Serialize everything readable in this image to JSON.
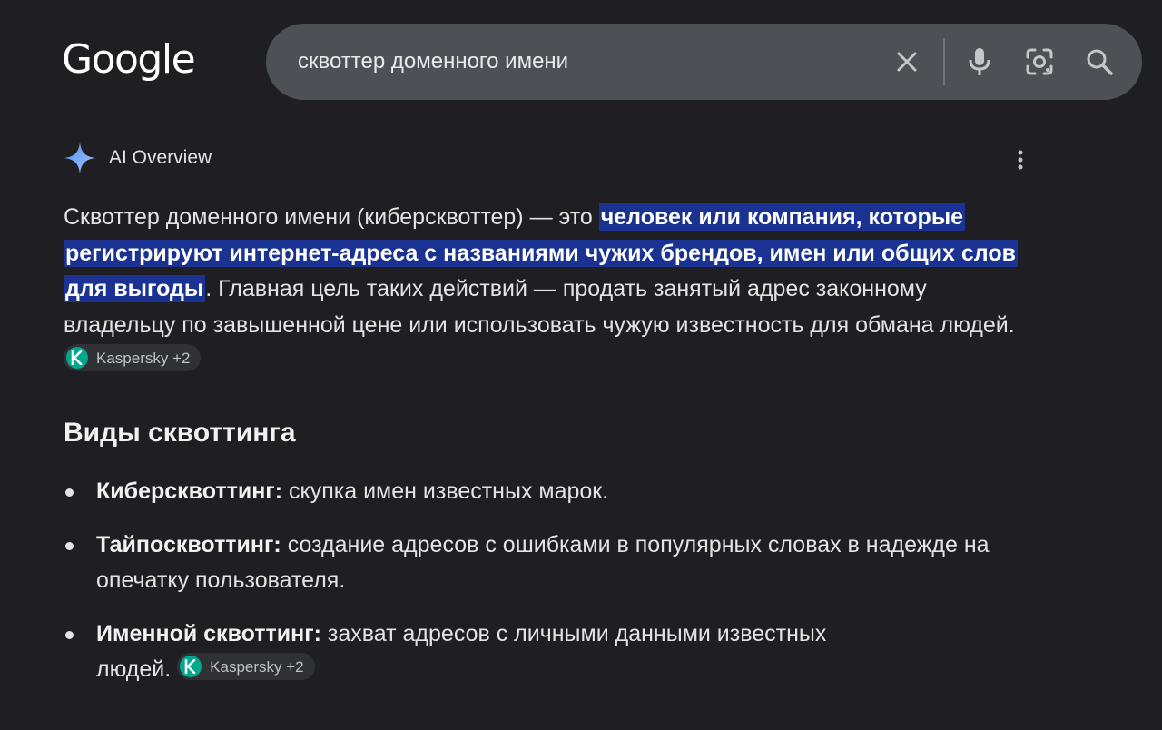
{
  "logo": "Google",
  "search": {
    "query": "сквоттер доменного имени",
    "icons": [
      "close-icon",
      "mic-icon",
      "lens-camera-icon",
      "search-icon"
    ]
  },
  "ai_overview": {
    "title": "AI Overview",
    "para_before": "Сквоттер доменного имени (киберсквоттер) — это ",
    "para_highlight": "человек или компания, которые регистрируют интернет-адреса с названиями чужих брендов, имен или общих слов для выгоды",
    "para_after": ". Главная цель таких действий — продать занятый адрес законному владельцу по завышенной цене или использовать чужую известность для обмана людей.",
    "source_chip": "Kaspersky +2"
  },
  "section": {
    "heading": "Виды сквоттинга",
    "items": [
      {
        "term": "Киберсквоттинг:",
        "text": " скупка имен известных марок."
      },
      {
        "term": "Тайпосквоттинг:",
        "text": " создание адресов с ошибками в популярных словах в надежде на опечатку пользователя."
      },
      {
        "term": "Именной сквоттинг:",
        "text": " захват адресов с личными данными известных людей.",
        "chip": "Kaspersky +2"
      }
    ]
  },
  "colors": {
    "background": "#1f1f23",
    "searchbar": "#4d5156",
    "highlight": "#1a3291",
    "kaspersky": "#00a88e"
  }
}
